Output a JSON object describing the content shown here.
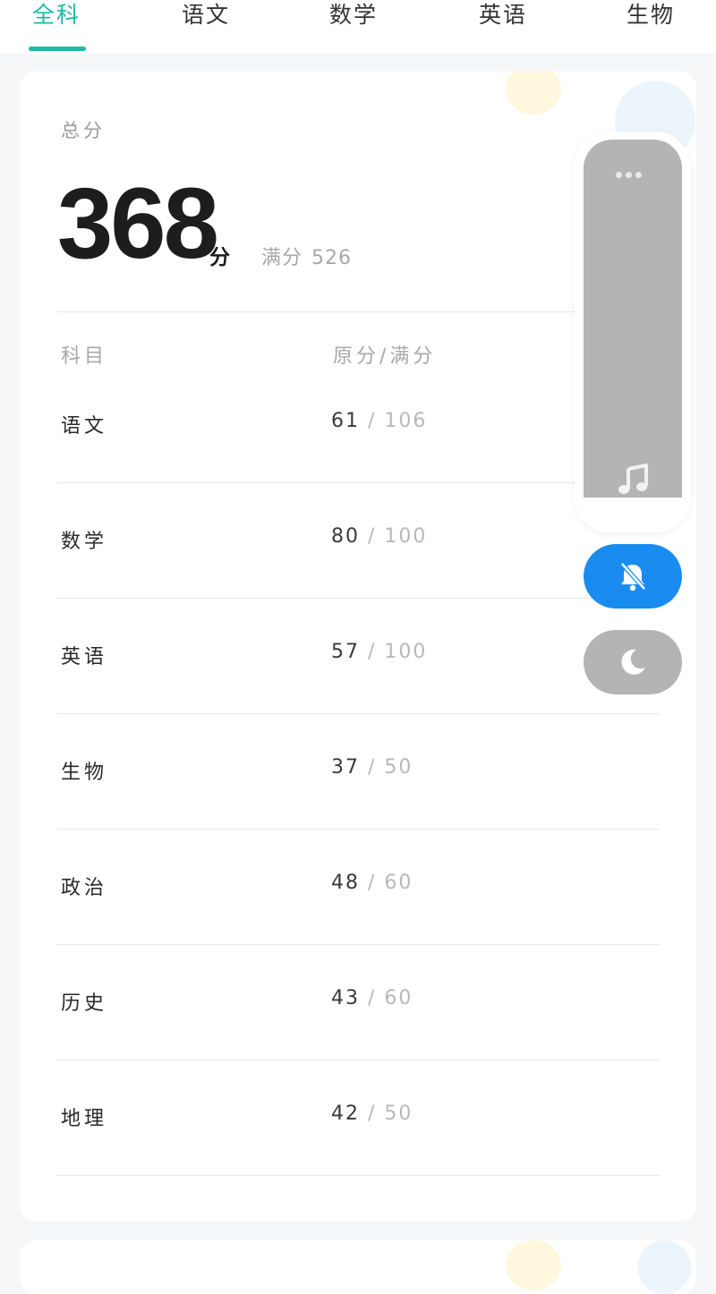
{
  "tabs": [
    {
      "label": "全科",
      "active": true
    },
    {
      "label": "语文",
      "active": false
    },
    {
      "label": "数学",
      "active": false
    },
    {
      "label": "英语",
      "active": false
    },
    {
      "label": "生物",
      "active": false
    }
  ],
  "summary": {
    "label": "总分",
    "score": "368",
    "unit": "分",
    "full_label": "满分",
    "full_value": "526"
  },
  "table": {
    "headers": {
      "subject": "科目",
      "score": "原分/满分"
    },
    "rows": [
      {
        "subject": "语文",
        "score": "61",
        "full": "106"
      },
      {
        "subject": "数学",
        "score": "80",
        "full": "100"
      },
      {
        "subject": "英语",
        "score": "57",
        "full": "100"
      },
      {
        "subject": "生物",
        "score": "37",
        "full": "50"
      },
      {
        "subject": "政治",
        "score": "48",
        "full": "60"
      },
      {
        "subject": "历史",
        "score": "43",
        "full": "60"
      },
      {
        "subject": "地理",
        "score": "42",
        "full": "50"
      }
    ]
  },
  "float_panel": {
    "icons": [
      "more-icon",
      "music-note-icon",
      "bell-off-icon",
      "moon-icon"
    ],
    "colors": {
      "track": "#b4b4b4",
      "mute_button": "#1a8cf0",
      "dark_mode_button": "#b4b4b4"
    }
  },
  "colors": {
    "accent": "#1fb9a6"
  }
}
